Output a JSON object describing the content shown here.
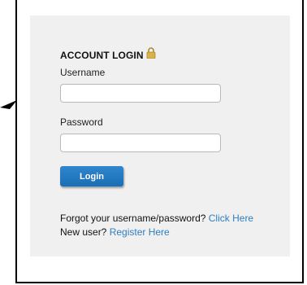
{
  "form": {
    "title": "ACCOUNT LOGIN",
    "lock_icon": "lock-icon",
    "username_label": "Username",
    "username_value": "",
    "password_label": "Password",
    "password_value": "",
    "login_label": "Login"
  },
  "footer": {
    "forgot_text": "Forgot your username/password?",
    "forgot_link": "Click Here",
    "new_user_text": "New user?",
    "register_link": "Register Here"
  },
  "colors": {
    "panel_bg": "#f0f0f0",
    "button": "#1e73be",
    "link": "#2f7ec2",
    "lock": "#d9b24a"
  }
}
